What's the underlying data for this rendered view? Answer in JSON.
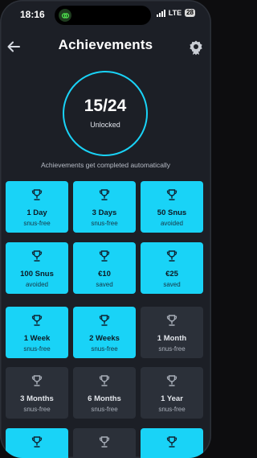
{
  "status_bar": {
    "time": "18:16",
    "network": "LTE",
    "battery": "28"
  },
  "header": {
    "title": "Achievements"
  },
  "progress": {
    "count": "15/24",
    "label": "Unlocked",
    "unlocked": 15,
    "total": 24
  },
  "subtitle": "Achievements get completed automatically",
  "colors": {
    "accent": "#19d3f7",
    "background": "#1c1f26",
    "locked": "#2b3039"
  },
  "achievements": [
    {
      "title": "1 Day",
      "subtitle": "snus-free",
      "unlocked": true,
      "icon": "trophy-icon"
    },
    {
      "title": "3 Days",
      "subtitle": "snus-free",
      "unlocked": true,
      "icon": "trophy-icon"
    },
    {
      "title": "50 Snus",
      "subtitle": "avoided",
      "unlocked": true,
      "icon": "trophy-icon"
    },
    {
      "title": "100 Snus",
      "subtitle": "avoided",
      "unlocked": true,
      "icon": "trophy-icon"
    },
    {
      "title": "€10",
      "subtitle": "saved",
      "unlocked": true,
      "icon": "trophy-icon"
    },
    {
      "title": "€25",
      "subtitle": "saved",
      "unlocked": true,
      "icon": "trophy-icon"
    },
    {
      "title": "1 Week",
      "subtitle": "snus-free",
      "unlocked": true,
      "icon": "trophy-icon"
    },
    {
      "title": "2 Weeks",
      "subtitle": "snus-free",
      "unlocked": true,
      "icon": "trophy-icon"
    },
    {
      "title": "1 Month",
      "subtitle": "snus-free",
      "unlocked": false,
      "icon": "trophy-icon"
    },
    {
      "title": "3 Months",
      "subtitle": "snus-free",
      "unlocked": false,
      "icon": "trophy-icon"
    },
    {
      "title": "6 Months",
      "subtitle": "snus-free",
      "unlocked": false,
      "icon": "trophy-icon"
    },
    {
      "title": "1 Year",
      "subtitle": "snus-free",
      "unlocked": false,
      "icon": "trophy-icon"
    },
    {
      "title": "",
      "subtitle": "",
      "unlocked": true,
      "icon": "trophy-icon"
    },
    {
      "title": "",
      "subtitle": "",
      "unlocked": false,
      "icon": "trophy-icon"
    },
    {
      "title": "",
      "subtitle": "",
      "unlocked": true,
      "icon": "trophy-icon"
    }
  ]
}
